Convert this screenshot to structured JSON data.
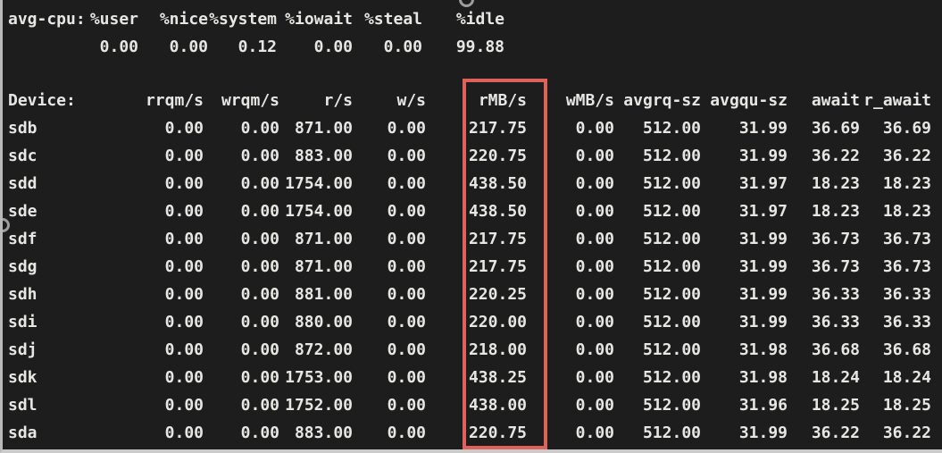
{
  "terminal": {
    "cpu": {
      "label": "avg-cpu:",
      "headers": [
        "%user",
        "%nice",
        "%system",
        "%iowait",
        "%steal",
        "%idle"
      ],
      "values": [
        "0.00",
        "0.00",
        "0.12",
        "0.00",
        "0.00",
        "99.88"
      ]
    },
    "device_table": {
      "headers": [
        "Device:",
        "rrqm/s",
        "wrqm/s",
        "r/s",
        "w/s",
        "rMB/s",
        "wMB/s",
        "avgrq-sz",
        "avgqu-sz",
        "await",
        "r_await"
      ],
      "rows": [
        [
          "sdb",
          "0.00",
          "0.00",
          "871.00",
          "0.00",
          "217.75",
          "0.00",
          "512.00",
          "31.99",
          "36.69",
          "36.69"
        ],
        [
          "sdc",
          "0.00",
          "0.00",
          "883.00",
          "0.00",
          "220.75",
          "0.00",
          "512.00",
          "31.99",
          "36.22",
          "36.22"
        ],
        [
          "sdd",
          "0.00",
          "0.00",
          "1754.00",
          "0.00",
          "438.50",
          "0.00",
          "512.00",
          "31.97",
          "18.23",
          "18.23"
        ],
        [
          "sde",
          "0.00",
          "0.00",
          "1754.00",
          "0.00",
          "438.50",
          "0.00",
          "512.00",
          "31.97",
          "18.23",
          "18.23"
        ],
        [
          "sdf",
          "0.00",
          "0.00",
          "871.00",
          "0.00",
          "217.75",
          "0.00",
          "512.00",
          "31.99",
          "36.73",
          "36.73"
        ],
        [
          "sdg",
          "0.00",
          "0.00",
          "871.00",
          "0.00",
          "217.75",
          "0.00",
          "512.00",
          "31.99",
          "36.73",
          "36.73"
        ],
        [
          "sdh",
          "0.00",
          "0.00",
          "881.00",
          "0.00",
          "220.25",
          "0.00",
          "512.00",
          "31.99",
          "36.33",
          "36.33"
        ],
        [
          "sdi",
          "0.00",
          "0.00",
          "880.00",
          "0.00",
          "220.00",
          "0.00",
          "512.00",
          "31.99",
          "36.33",
          "36.33"
        ],
        [
          "sdj",
          "0.00",
          "0.00",
          "872.00",
          "0.00",
          "218.00",
          "0.00",
          "512.00",
          "31.98",
          "36.68",
          "36.68"
        ],
        [
          "sdk",
          "0.00",
          "0.00",
          "1753.00",
          "0.00",
          "438.25",
          "0.00",
          "512.00",
          "31.98",
          "18.24",
          "18.24"
        ],
        [
          "sdl",
          "0.00",
          "0.00",
          "1752.00",
          "0.00",
          "438.00",
          "0.00",
          "512.00",
          "31.96",
          "18.25",
          "18.25"
        ],
        [
          "sda",
          "0.00",
          "0.00",
          "883.00",
          "0.00",
          "220.75",
          "0.00",
          "512.00",
          "31.99",
          "36.22",
          "36.22"
        ]
      ]
    },
    "highlight": {
      "column": "rMB/s",
      "color": "#e0605a"
    },
    "colors": {
      "background": "#1d1d1e",
      "text": "#e6e6e3"
    }
  }
}
